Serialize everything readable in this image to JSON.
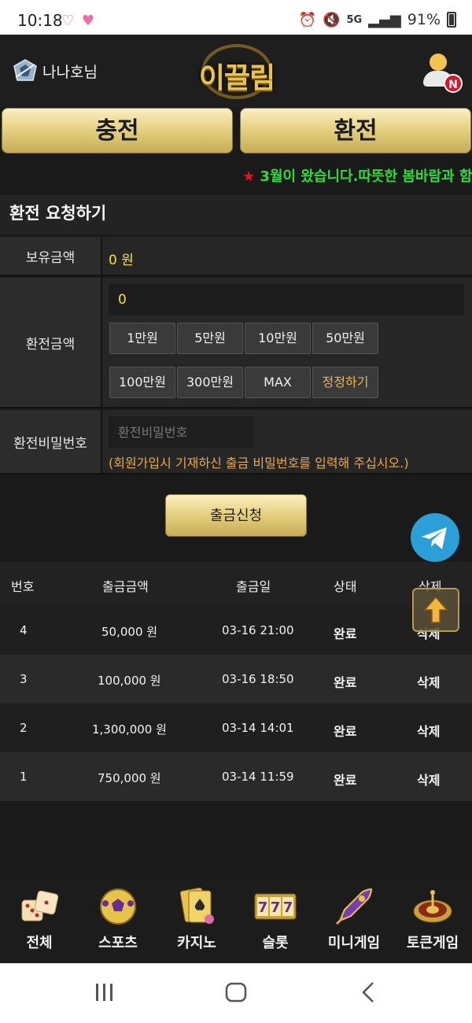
{
  "status_bar": {
    "time": "10:18",
    "hearts": "♡ ♥",
    "signal": "5G",
    "battery": "91%"
  },
  "header": {
    "username": "나나호님",
    "logo": "이끌림",
    "notification_badge": "N"
  },
  "actions": {
    "charge": "충전",
    "exchange": "환전"
  },
  "notice": {
    "star": "★",
    "text": "3월이 왔습니다.따뜻한 봄바람과 함"
  },
  "form": {
    "title": "환전 요청하기",
    "balance_label": "보유금액",
    "balance_value": "0 원",
    "amount_label": "환전금액",
    "amount_value": "0",
    "chips": [
      "1만원",
      "5만원",
      "10만원",
      "50만원",
      "100만원",
      "300만원",
      "MAX",
      "정정하기"
    ],
    "password_label": "환전비밀번호",
    "password_placeholder": "환전비밀번호",
    "password_note": "(회원가입시 기재하신 출금 비밀번호를 입력해 주십시오.)",
    "submit": "출금신청"
  },
  "table": {
    "headers": [
      "번호",
      "출금금액",
      "출금일",
      "상태",
      "삭제"
    ],
    "rows": [
      {
        "no": "4",
        "amount": "50,000 원",
        "date": "03-16 21:00",
        "status": "완료",
        "action": "삭제"
      },
      {
        "no": "3",
        "amount": "100,000 원",
        "date": "03-16 18:50",
        "status": "완료",
        "action": "삭제"
      },
      {
        "no": "2",
        "amount": "1,300,000 원",
        "date": "03-14 14:01",
        "status": "완료",
        "action": "삭제"
      },
      {
        "no": "1",
        "amount": "750,000 원",
        "date": "03-14 11:59",
        "status": "완료",
        "action": "삭제"
      }
    ]
  },
  "bottom_nav": [
    {
      "label": "전체",
      "icon": "dice-icon"
    },
    {
      "label": "스포츠",
      "icon": "soccer-ball-icon"
    },
    {
      "label": "카지노",
      "icon": "cards-icon"
    },
    {
      "label": "슬롯",
      "icon": "slot-777-icon"
    },
    {
      "label": "미니게임",
      "icon": "rocket-icon"
    },
    {
      "label": "토큰게임",
      "icon": "roulette-icon"
    }
  ],
  "colors": {
    "gold": "#e6d283",
    "notice_green": "#2fdc3c",
    "value_yellow": "#f2e23a",
    "note_orange": "#e9a94a"
  }
}
